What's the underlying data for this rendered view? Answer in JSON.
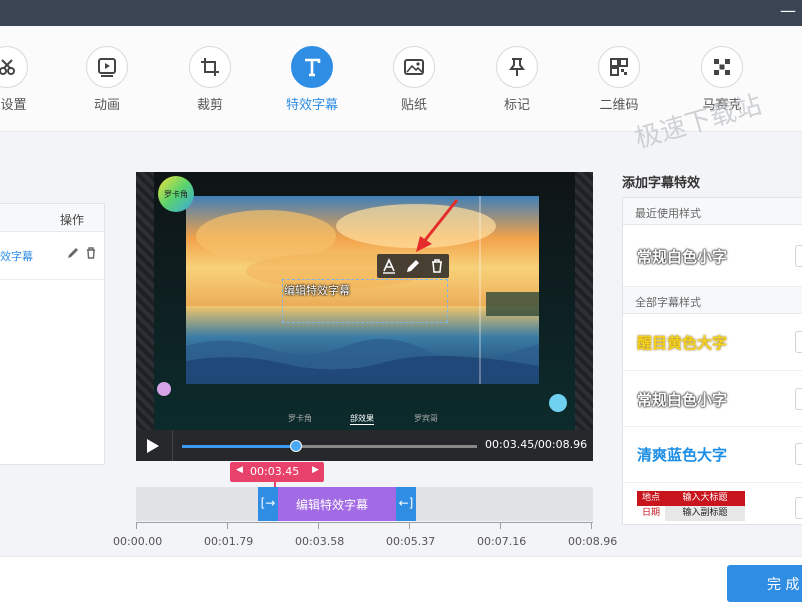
{
  "window": {
    "minimize_glyph": "—"
  },
  "toolbar": {
    "items": [
      {
        "label": "础设置",
        "icon": "scissors-icon"
      },
      {
        "label": "动画",
        "icon": "play-frame-icon"
      },
      {
        "label": "裁剪",
        "icon": "crop-icon"
      },
      {
        "label": "特效字幕",
        "icon": "text-t-icon",
        "active": true
      },
      {
        "label": "贴纸",
        "icon": "image-icon"
      },
      {
        "label": "标记",
        "icon": "pin-icon"
      },
      {
        "label": "二维码",
        "icon": "qrcode-icon"
      },
      {
        "label": "马赛克",
        "icon": "mosaic-icon"
      }
    ]
  },
  "left_panel": {
    "header_op": "操作",
    "row_text": "效字幕"
  },
  "player": {
    "badge": "罗卡角",
    "caption": "编辑特效字幕",
    "subtabs": [
      "罗卡角",
      "部效果",
      "罗宾哥"
    ],
    "time_display": "00:03.45/00:08.96",
    "progress": 0.385
  },
  "timeline": {
    "current_time": "00:03.45",
    "clip_label": "编辑特效字幕",
    "ticks": [
      "00:00.00",
      "00:01.79",
      "00:03.58",
      "00:05.37",
      "00:07.16",
      "00:08.96"
    ]
  },
  "right_panel": {
    "title": "添加字幕特效",
    "recent_section": "最近使用样式",
    "all_section": "全部字幕样式",
    "recent_items": [
      {
        "label": "常规白色小字",
        "color": "#ffffff"
      }
    ],
    "all_items": [
      {
        "label": "醒目黄色大字",
        "color": "#f7d21c"
      },
      {
        "label": "常规白色小字",
        "color": "#ffffff"
      },
      {
        "label": "清爽蓝色大字",
        "color": "#1c8ee6"
      }
    ],
    "template": {
      "tag1": "地点",
      "main1": "输入大标题",
      "tag2": "日期",
      "main2": "输入副标题"
    }
  },
  "watermark": "极速下载站",
  "footer": {
    "finish_label": "完 成"
  },
  "colors": {
    "accent": "#2f8de4",
    "timeline_marker": "#e8426a",
    "clip": "#a26ae4"
  }
}
